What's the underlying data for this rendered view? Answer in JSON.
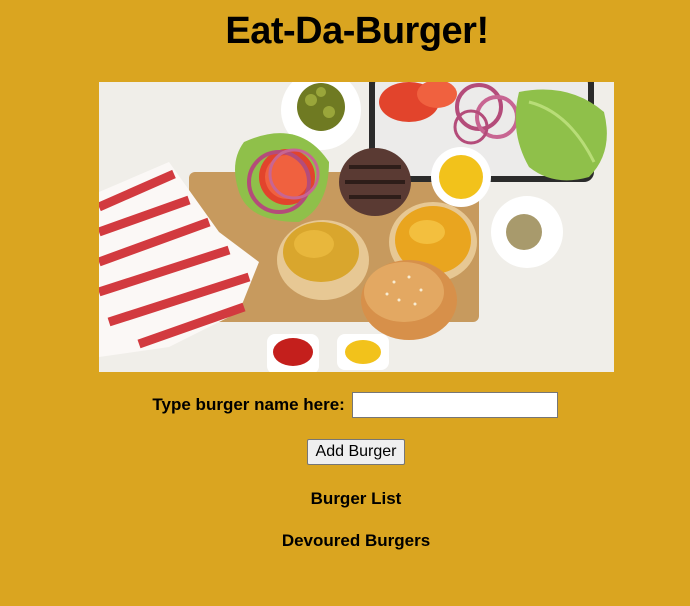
{
  "header": {
    "title": "Eat-Da-Burger!"
  },
  "hero": {
    "image": "burger-ingredients-photo"
  },
  "form": {
    "label": "Type burger name here:",
    "input_value": "",
    "input_placeholder": "",
    "submit_label": "Add Burger"
  },
  "lists": {
    "burger_list_title": "Burger List",
    "devoured_title": "Devoured Burgers"
  },
  "colors": {
    "background": "#DAA520"
  }
}
